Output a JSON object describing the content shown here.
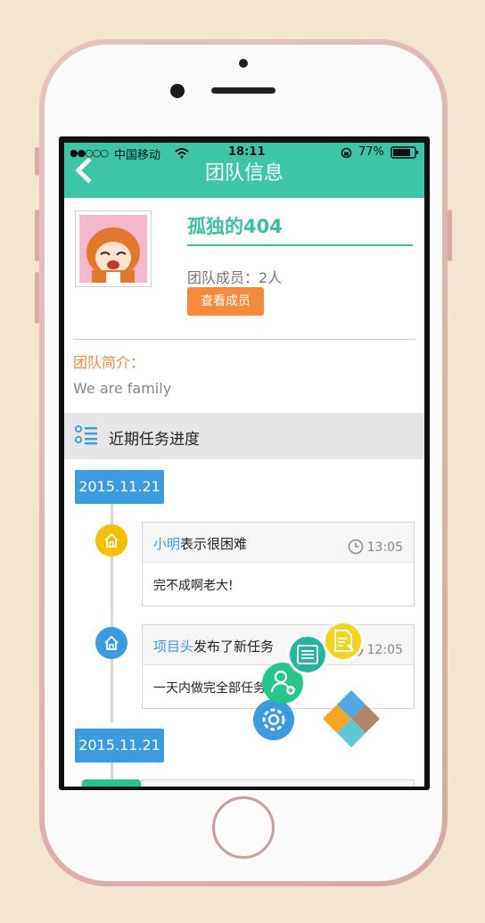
{
  "status_bar": {
    "signal": "●●○○○",
    "carrier": "中国移动",
    "time": "18:11",
    "battery": "77%"
  },
  "header": {
    "title": "团队信息",
    "color": "#3dc5a8"
  },
  "team": {
    "name": "孤独的404",
    "members_label": "团队成员：2人",
    "view_members_button": "查看成员",
    "intro_label": "团队简介：",
    "intro_text": "We are family"
  },
  "progress": {
    "section_title": "近期任务进度",
    "groups": [
      {
        "date": "2015.11.21"
      },
      {
        "date": "2015.11.21"
      }
    ],
    "tasks": [
      {
        "who": "小明",
        "action": "表示很困难",
        "time": "13:05",
        "body": "完不成啊老大!",
        "node_color": "#f3c000"
      },
      {
        "who": "项目头",
        "action": "发布了新任务",
        "time": "12:05",
        "body": "一天内做完全部任务",
        "node_color": "#3b9ae0"
      }
    ]
  },
  "fab_menu": {
    "items": [
      {
        "icon": "settings-gear-icon",
        "color": "#3b9ae0"
      },
      {
        "icon": "add-member-icon",
        "color": "#28c58b"
      },
      {
        "icon": "task-list-icon",
        "color": "#22b5a0"
      },
      {
        "icon": "edit-document-icon",
        "color": "#f5d21e"
      }
    ],
    "toggle_icon": "diamond-menu-icon"
  },
  "colors": {
    "accent": "#3dc5a8",
    "orange": "#f58a3d",
    "blue": "#3b9ae0"
  }
}
